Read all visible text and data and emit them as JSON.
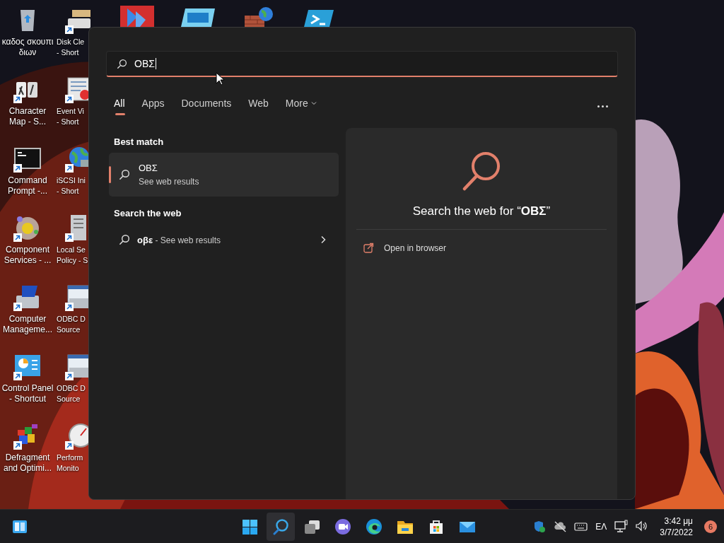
{
  "desktop_icons": {
    "column_1": [
      {
        "kind": "recycle-bin",
        "label": "καδος σκουπι\nδιων",
        "shortcut": false
      },
      {
        "kind": "character-map",
        "label": "Character\nMap - S...",
        "shortcut": true
      },
      {
        "kind": "command-prompt",
        "label": "Command\nPrompt -...",
        "shortcut": true
      },
      {
        "kind": "component-services",
        "label": "Component\nServices - ...",
        "shortcut": true
      },
      {
        "kind": "computer-management",
        "label": "Computer\nManageme...",
        "shortcut": true
      },
      {
        "kind": "control-panel",
        "label": "Control Panel\n- Shortcut",
        "shortcut": true
      },
      {
        "kind": "defragment",
        "label": "Defragment\nand Optimi...",
        "shortcut": true
      }
    ],
    "column_2": [
      {
        "kind": "disk-cleanup",
        "label": "Disk Cle\n- Short",
        "shortcut": true
      },
      {
        "kind": "event-viewer",
        "label": "Event Vi\n- Short",
        "shortcut": true
      },
      {
        "kind": "iscsi",
        "label": "iSCSI Ini\n- Short",
        "shortcut": true
      },
      {
        "kind": "local-policy",
        "label": "Local Se\nPolicy - S",
        "shortcut": true
      },
      {
        "kind": "odbc",
        "label": "ODBC D\nSource",
        "shortcut": true
      },
      {
        "kind": "odbc",
        "label": "ODBC D\nSource",
        "shortcut": true
      },
      {
        "kind": "performance",
        "label": "Perform\nMonito",
        "shortcut": true
      }
    ],
    "top_row": [
      {
        "kind": "automate"
      },
      {
        "kind": "window"
      },
      {
        "kind": "firewall"
      },
      {
        "kind": "powershell"
      }
    ]
  },
  "search_panel": {
    "query": "ΟΒΣ",
    "tabs": [
      {
        "label": "All",
        "selected": true,
        "kind": "tab"
      },
      {
        "label": "Apps",
        "selected": false,
        "kind": "tab"
      },
      {
        "label": "Documents",
        "selected": false,
        "kind": "tab"
      },
      {
        "label": "Web",
        "selected": false,
        "kind": "tab"
      },
      {
        "label": "More",
        "selected": false,
        "kind": "dropdown"
      }
    ],
    "best_match": {
      "heading": "Best match",
      "title": "ΟΒΣ",
      "subtitle": "See web results",
      "selected": true
    },
    "search_the_web": {
      "heading": "Search the web",
      "items": [
        {
          "text": "**οβε** - See web results"
        }
      ]
    },
    "preview": {
      "title": "Search the web for “**ΟΒΣ**”",
      "actions": [
        {
          "label": "Open in browser"
        }
      ]
    }
  },
  "taskbar": {
    "apps": [
      {
        "kind": "start",
        "selected": false
      },
      {
        "kind": "search",
        "selected": true
      },
      {
        "kind": "task-view",
        "selected": false
      },
      {
        "kind": "teams",
        "selected": false
      },
      {
        "kind": "edge",
        "selected": false
      },
      {
        "kind": "explorer",
        "selected": false
      },
      {
        "kind": "store",
        "selected": false
      },
      {
        "kind": "mail",
        "selected": false
      }
    ],
    "tray": [
      {
        "kind": "security"
      },
      {
        "kind": "cloud-off"
      },
      {
        "kind": "keyboard"
      },
      {
        "kind": "language",
        "label": "ΕΛ"
      },
      {
        "kind": "network"
      },
      {
        "kind": "volume"
      }
    ],
    "time": "3:42 μμ",
    "date": "3/7/2022",
    "notification_count": "6"
  }
}
